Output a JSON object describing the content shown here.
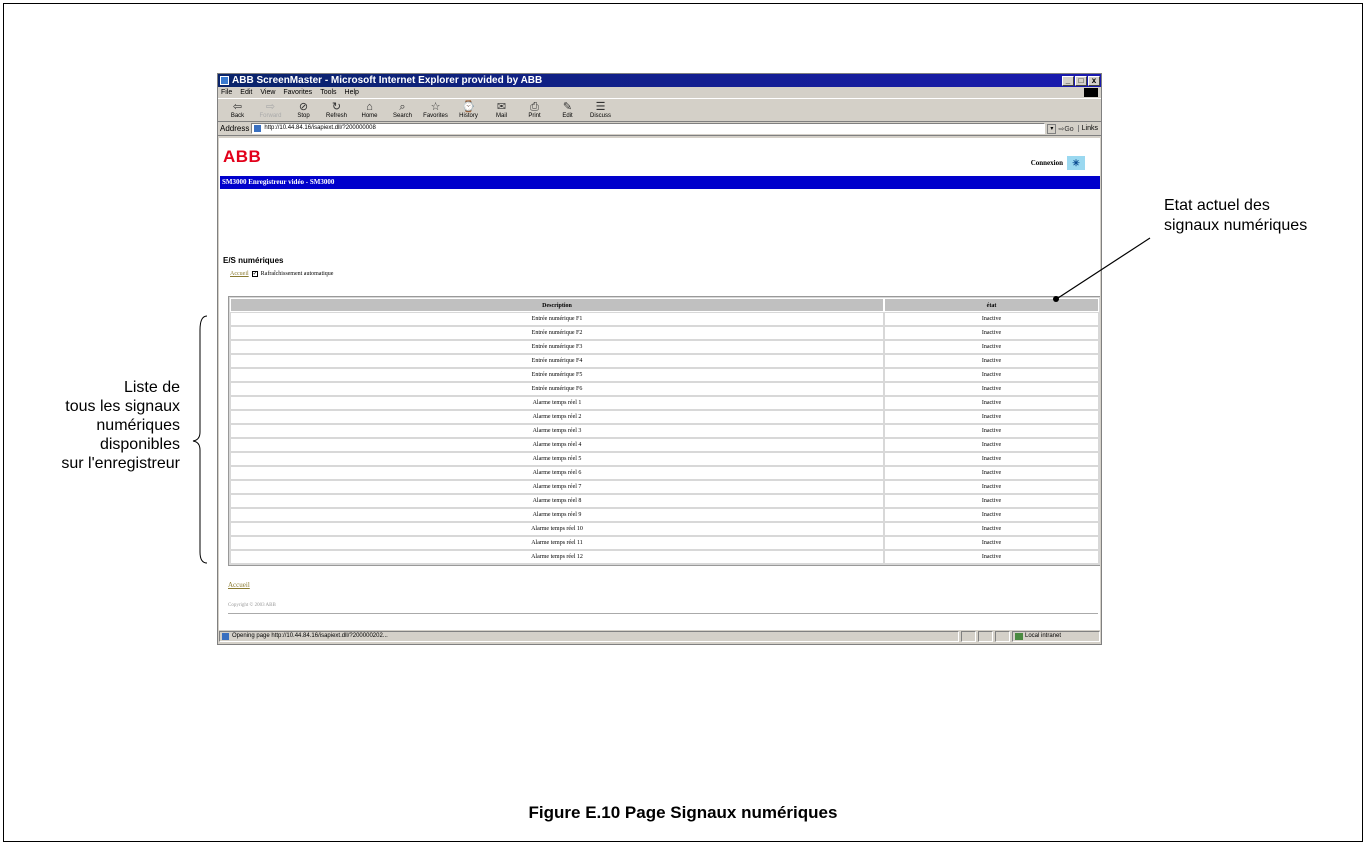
{
  "window": {
    "title": "ABB ScreenMaster - Microsoft Internet Explorer provided by ABB",
    "controls": [
      "_",
      "□",
      "x"
    ]
  },
  "menu": [
    "File",
    "Edit",
    "View",
    "Favorites",
    "Tools",
    "Help"
  ],
  "toolbar": [
    {
      "label": "Back",
      "icon": "⇦",
      "enabled": true
    },
    {
      "label": "Forward",
      "icon": "⇨",
      "enabled": false
    },
    {
      "label": "Stop",
      "icon": "⊘",
      "enabled": true
    },
    {
      "label": "Refresh",
      "icon": "↻",
      "enabled": true
    },
    {
      "label": "Home",
      "icon": "⌂",
      "enabled": true
    },
    {
      "label": "Search",
      "icon": "⌕",
      "enabled": true
    },
    {
      "label": "Favorites",
      "icon": "☆",
      "enabled": true
    },
    {
      "label": "History",
      "icon": "⌚",
      "enabled": true
    },
    {
      "label": "Mail",
      "icon": "✉",
      "enabled": true
    },
    {
      "label": "Print",
      "icon": "⎙",
      "enabled": true
    },
    {
      "label": "Edit",
      "icon": "✎",
      "enabled": true
    },
    {
      "label": "Discuss",
      "icon": "☰",
      "enabled": true
    }
  ],
  "address": {
    "label": "Address",
    "url": "http://10.44.84.16/isapiext.dll/?200000008",
    "go": "Go",
    "links": "Links"
  },
  "page": {
    "logo": "ABB",
    "connexion": "Connexion",
    "banner": "SM3000 Enregistreur vidéo - SM3000",
    "section_title": "E/S numériques",
    "home_link": "Accueil",
    "auto_refresh_label": "Rafraîchissement automatique",
    "auto_refresh_checked": true,
    "table": {
      "headers": [
        "Description",
        "état"
      ],
      "rows": [
        [
          "Entrée numérique F1",
          "Inactive"
        ],
        [
          "Entrée numérique F2",
          "Inactive"
        ],
        [
          "Entrée numérique F3",
          "Inactive"
        ],
        [
          "Entrée numérique F4",
          "Inactive"
        ],
        [
          "Entrée numérique F5",
          "Inactive"
        ],
        [
          "Entrée numérique F6",
          "Inactive"
        ],
        [
          "Alarme temps réel 1",
          "Inactive"
        ],
        [
          "Alarme temps réel 2",
          "Inactive"
        ],
        [
          "Alarme temps réel 3",
          "Inactive"
        ],
        [
          "Alarme temps réel 4",
          "Inactive"
        ],
        [
          "Alarme temps réel 5",
          "Inactive"
        ],
        [
          "Alarme temps réel 6",
          "Inactive"
        ],
        [
          "Alarme temps réel 7",
          "Inactive"
        ],
        [
          "Alarme temps réel 8",
          "Inactive"
        ],
        [
          "Alarme temps réel 9",
          "Inactive"
        ],
        [
          "Alarme temps réel 10",
          "Inactive"
        ],
        [
          "Alarme temps réel 11",
          "Inactive"
        ],
        [
          "Alarme temps réel 12",
          "Inactive"
        ]
      ]
    },
    "footer_link": "Accueil",
    "copyright": "Copyright © 2003 ABB"
  },
  "status": {
    "text": "Opening page http://10.44.84.16/isapiext.dll/?200000202...",
    "zone": "Local intranet"
  },
  "annotations": {
    "right": [
      "Etat actuel des",
      "signaux numériques"
    ],
    "left": [
      "Liste de",
      "tous les signaux",
      "numériques",
      "disponibles",
      "sur l'enregistreur"
    ]
  },
  "caption": "Figure E.10 Page Signaux numériques"
}
